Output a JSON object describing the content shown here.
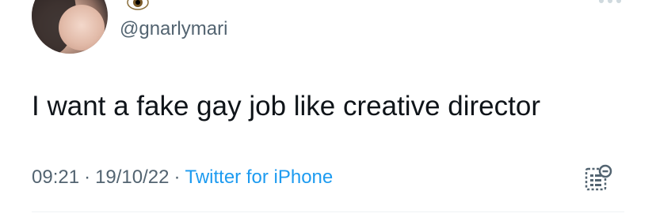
{
  "author": {
    "display_name_emoji": "eye-emoji",
    "handle": "@gnarlymari",
    "avatar": "profile-photo"
  },
  "header": {
    "more_icon": "more-dots-icon"
  },
  "tweet": {
    "text": "I want a fake gay job like creative director"
  },
  "meta": {
    "time": "09:21",
    "separator": "·",
    "date": "19/10/22",
    "source": "Twitter for iPhone"
  },
  "actions": {
    "analytics_icon": "analytics-icon"
  },
  "colors": {
    "text": "#0f1419",
    "secondary": "#536471",
    "link": "#1d9bf0",
    "divider": "#eff3f4"
  }
}
